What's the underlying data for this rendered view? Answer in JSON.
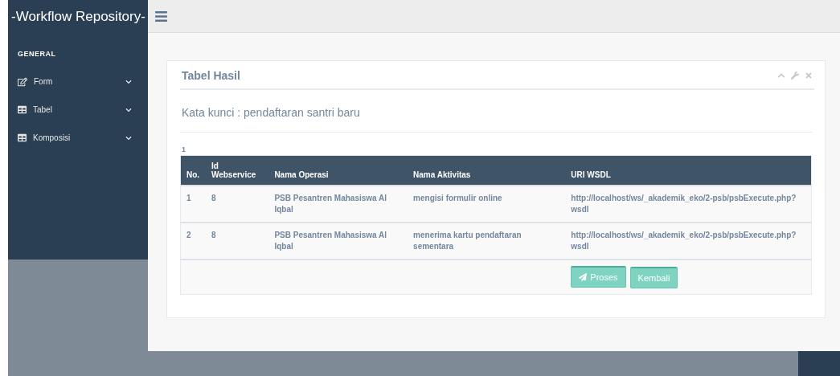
{
  "sidebar": {
    "title": "-Workflow Repository-",
    "section": "GENERAL",
    "items": [
      {
        "label": "Form",
        "kind": "edit"
      },
      {
        "label": "Tabel",
        "kind": "table"
      },
      {
        "label": "Komposisi",
        "kind": "table"
      }
    ]
  },
  "panel": {
    "title": "Tabel Hasil",
    "keyword": "Kata kunci : pendaftaran santri baru",
    "page": "1",
    "table": {
      "columns": [
        "No.",
        "Id Webservice",
        "Nama Operasi",
        "Nama Aktivitas",
        "URI WSDL"
      ],
      "rows": [
        [
          "1",
          "8",
          "PSB Pesantren Mahasiswa Al Iqbal",
          "mengisi formulir online",
          "http://localhost/ws/_akademik_eko/2-psb/psbExecute.php?wsdl"
        ],
        [
          "2",
          "8",
          "PSB Pesantren Mahasiswa Al Iqbal",
          "menerima kartu pendaftaran sementara",
          "http://localhost/ws/_akademik_eko/2-psb/psbExecute.php?wsdl"
        ]
      ]
    },
    "buttons": [
      {
        "label": "Proses",
        "kind": "send"
      },
      {
        "label": "Kembali",
        "kind": "plain"
      }
    ]
  }
}
